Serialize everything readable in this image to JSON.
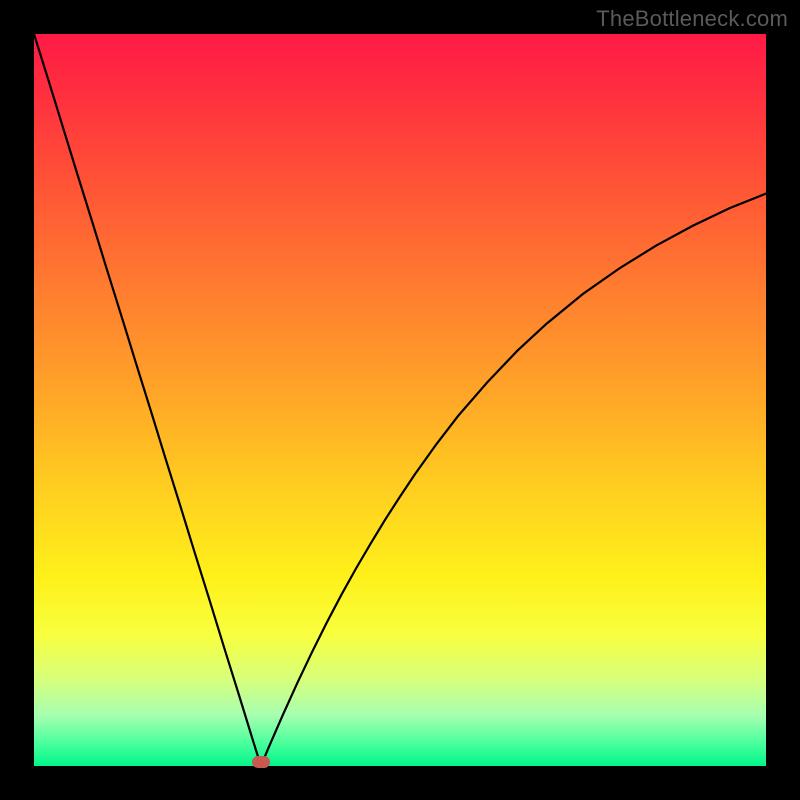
{
  "attribution": "TheBottleneck.com",
  "gradient_css": "linear-gradient(to bottom, #ff1a46 0%, #ff2f3f 8%, #ff5236 20%, #ff7a30 34%, #ffa228 48%, #ffce20 62%, #fff01a 74%, #f8ff3e 82%, #d8ff7a 88%, #a8ffb0 93%, #47ff9c 97%, #00f58a 100%)",
  "marker_color": "#c65a52",
  "chart_data": {
    "type": "line",
    "title": "",
    "xlabel": "",
    "ylabel": "",
    "xlim": [
      0,
      100
    ],
    "ylim": [
      0,
      100
    ],
    "x": [
      0,
      2,
      4,
      6,
      8,
      10,
      12,
      14,
      16,
      18,
      20,
      22,
      24,
      26,
      28,
      30,
      31,
      32,
      33,
      34,
      35,
      36,
      37,
      38,
      40,
      42,
      44,
      46,
      48,
      50,
      52,
      55,
      58,
      62,
      66,
      70,
      75,
      80,
      85,
      90,
      95,
      100
    ],
    "values": [
      100,
      93.6,
      87.1,
      80.6,
      74.2,
      67.7,
      61.3,
      54.8,
      48.4,
      41.9,
      35.5,
      29.0,
      22.6,
      16.1,
      9.7,
      3.2,
      0.0,
      2.4,
      4.7,
      7.0,
      9.2,
      11.4,
      13.5,
      15.6,
      19.6,
      23.4,
      27.0,
      30.4,
      33.7,
      36.8,
      39.8,
      44.0,
      47.9,
      52.5,
      56.7,
      60.4,
      64.5,
      68.0,
      71.1,
      73.8,
      76.2,
      78.2
    ],
    "marker": {
      "x": 31,
      "y": 0.5
    }
  }
}
